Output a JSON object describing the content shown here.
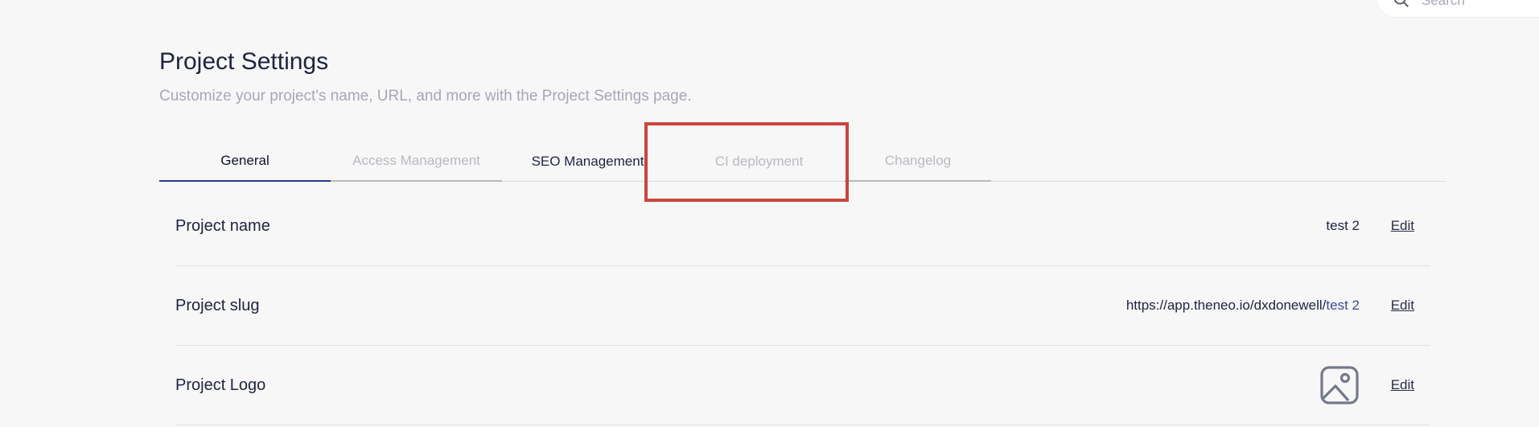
{
  "search": {
    "placeholder": "Search"
  },
  "header": {
    "title": "Project Settings",
    "subtitle": "Customize your project's name, URL, and more with the Project Settings page."
  },
  "tabs": [
    {
      "label": "General",
      "state": "active"
    },
    {
      "label": "Access Management",
      "state": "disabled"
    },
    {
      "label": "SEO Management",
      "state": "normal"
    },
    {
      "label": "CI deployment",
      "state": "disabled"
    },
    {
      "label": "Changelog",
      "state": "disabled"
    }
  ],
  "settings": {
    "project_name": {
      "label": "Project name",
      "value": "test 2",
      "edit": "Edit"
    },
    "project_slug": {
      "label": "Project slug",
      "url_prefix": "https://app.theneo.io/dxdonewell/",
      "url_slug": "test 2",
      "edit": "Edit"
    },
    "project_logo": {
      "label": "Project Logo",
      "edit": "Edit",
      "icon": "image-placeholder-icon"
    }
  },
  "colors": {
    "accent": "#303a86",
    "highlight_box": "#c9453f",
    "slug_link": "#3b4aa0"
  }
}
